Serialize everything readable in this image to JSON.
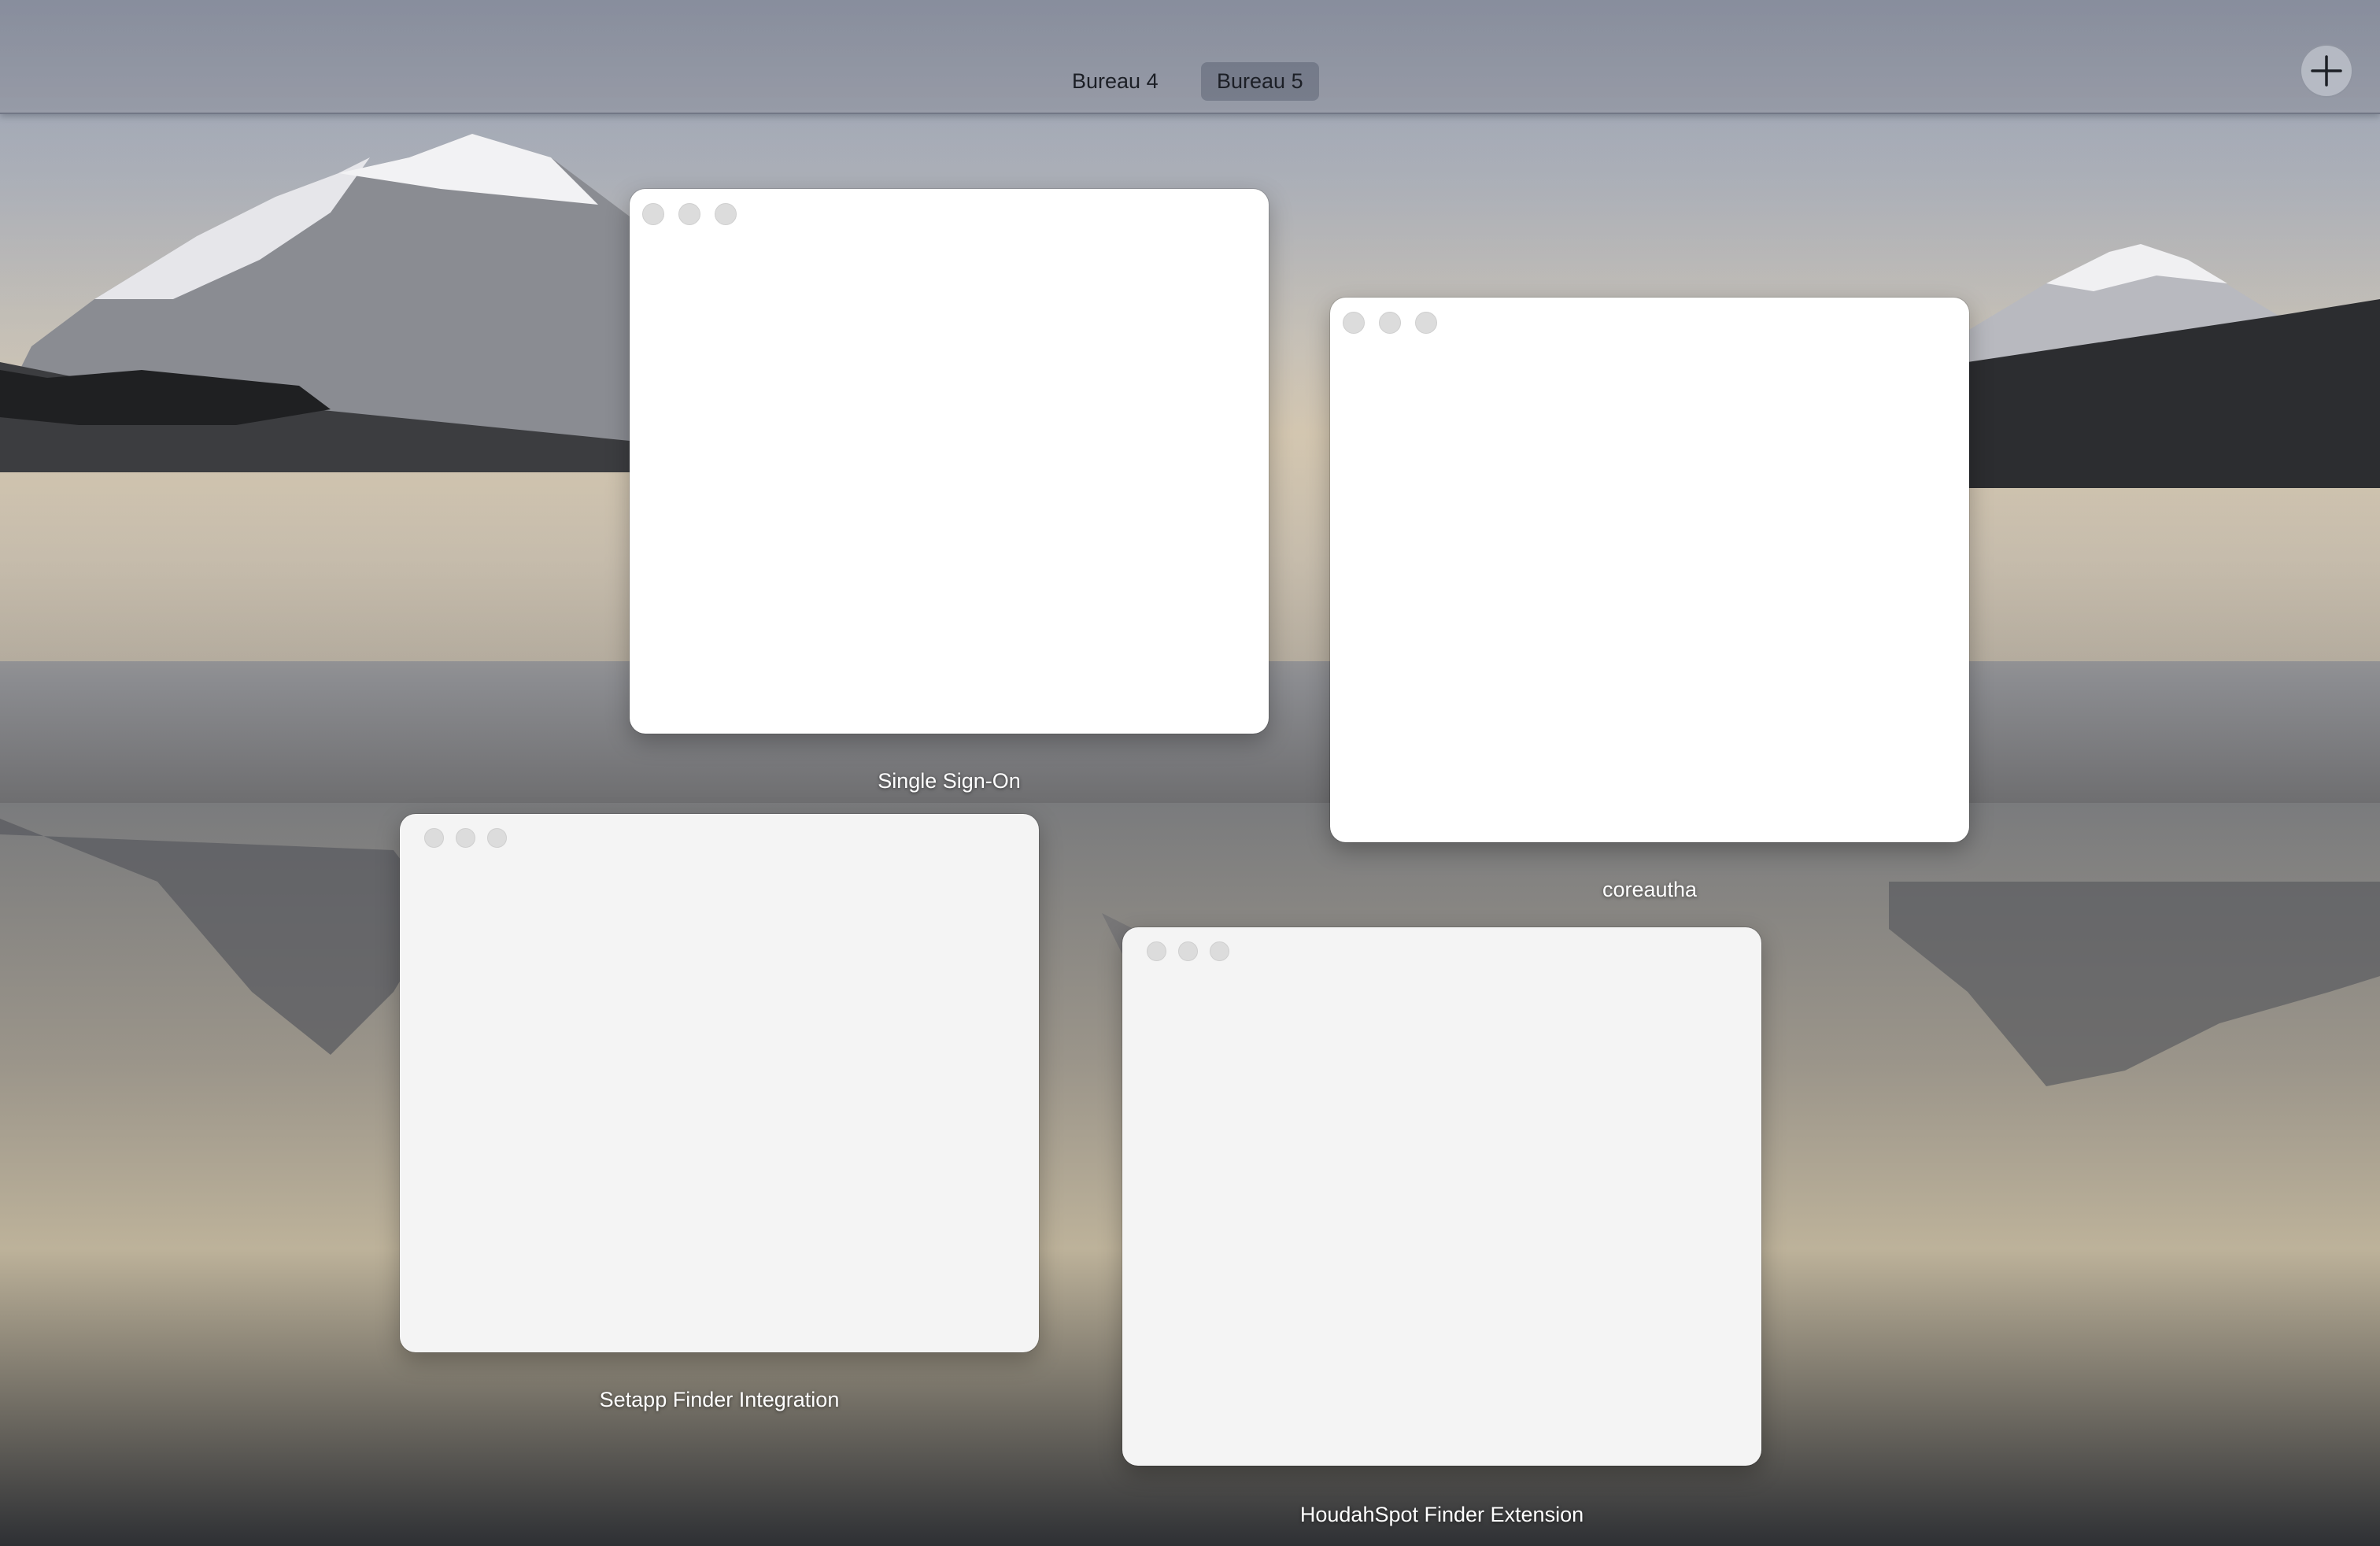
{
  "spaces_bar": {
    "tabs": [
      {
        "label": "Bureau 4",
        "active": false
      },
      {
        "label": "Bureau 5",
        "active": true
      }
    ],
    "add_space_icon": "plus-icon"
  },
  "windows": [
    {
      "title": "Single Sign-On",
      "style": "white"
    },
    {
      "title": "coreautha",
      "style": "white"
    },
    {
      "title": "Setapp Finder Integration",
      "style": "grey"
    },
    {
      "title": "HoudahSpot Finder Extension",
      "style": "grey"
    }
  ],
  "window_controls_icon": "traffic-light-dots-icon"
}
